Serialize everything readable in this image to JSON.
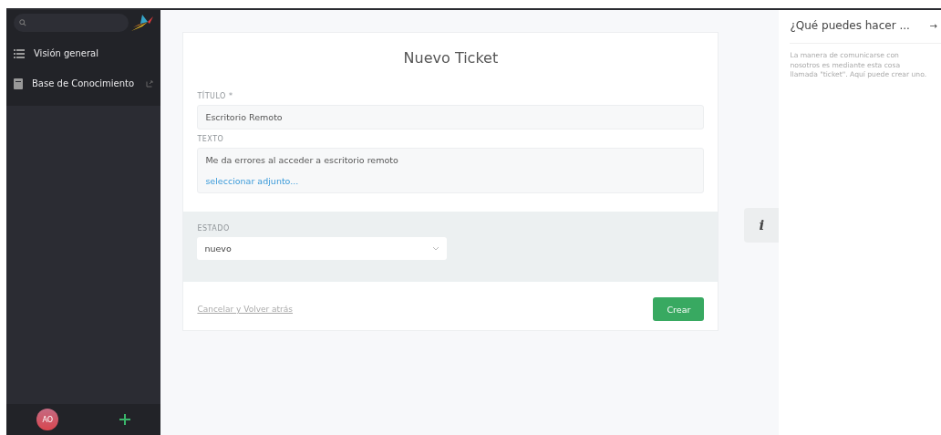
{
  "sidebar": {
    "items": [
      {
        "label": "Visión general",
        "kind": "overview"
      },
      {
        "label": "Base de Conocimiento",
        "kind": "knowledge"
      }
    ],
    "avatar": {
      "initials": "AO"
    }
  },
  "form": {
    "title": "Nuevo Ticket",
    "fields": [
      {
        "label": "TÍTULO *",
        "value": "Escritorio Remoto"
      },
      {
        "label": "TEXTO",
        "value": "Me da errores al acceder a escritorio remoto",
        "link": "seleccionar adjunto..."
      }
    ],
    "state": {
      "label": "ESTADO",
      "value": "nuevo"
    },
    "cancel": "Cancelar y Volver atrás",
    "submit": "Crear"
  },
  "info_tab": {
    "label": "i"
  },
  "aside": {
    "title": "¿Qué puedes hacer ...",
    "arrow": "→",
    "text": "La manera de comunicarse con nosotros es mediante esta cosa llamada \"ticket\". Aquí puede crear uno."
  }
}
